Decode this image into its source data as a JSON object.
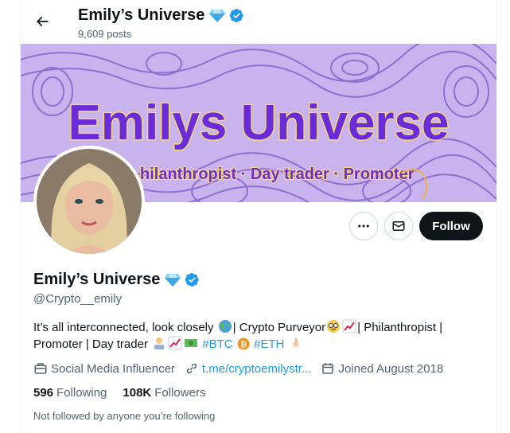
{
  "header": {
    "title": "Emily’s Universe",
    "posts": "9,609 posts"
  },
  "banner": {
    "headline": "Emilys Universe",
    "tagline": "hilanthropist · Day trader · Promoter",
    "background": "#c9b3ef",
    "text_color": "#6a2bd9"
  },
  "profile": {
    "name": "Emily’s Universe",
    "handle": "@Crypto__emily",
    "bio_line1": "It’s all interconnected, look closely",
    "bio_line1b": "| Crypto Purveyor",
    "bio_line1c": "| Philanthropist |",
    "bio_line2": "Promoter | Day trader",
    "hashtag_btc": "#BTC",
    "hashtag_eth": "#ETH",
    "category": "Social Media Influencer",
    "link": "t.me/cryptoemilystr...",
    "joined": "Joined August 2018",
    "following_count": "596",
    "following_label": "Following",
    "followers_count": "108K",
    "followers_label": "Followers",
    "not_followed": "Not followed by anyone you’re following"
  },
  "actions": {
    "follow_label": "Follow",
    "more_icon": "more-horizontal-icon",
    "message_icon": "envelope-icon"
  },
  "colors": {
    "accent": "#1d9bf0",
    "verified": "#1d9bf0",
    "follow_button": "#0f1419"
  }
}
